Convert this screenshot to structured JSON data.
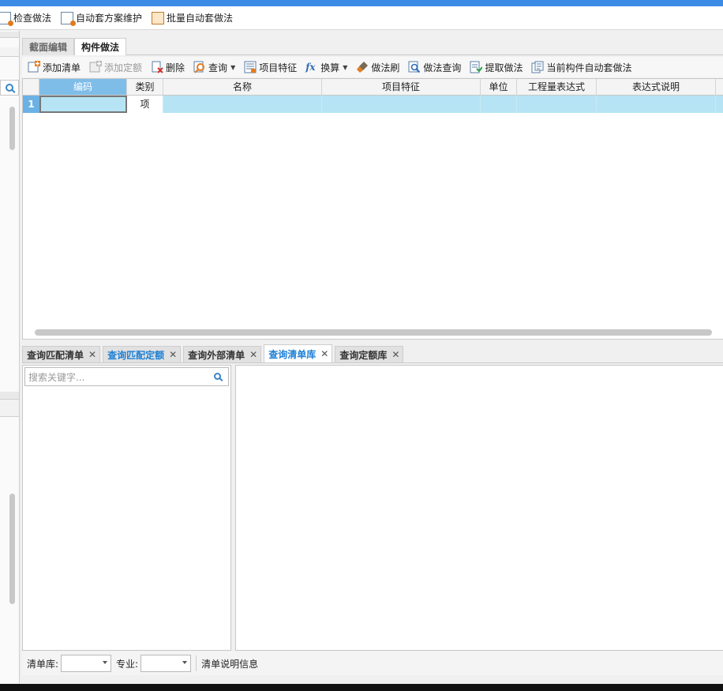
{
  "top_toolbar": {
    "items": [
      {
        "label": "检查做法",
        "icon": "check-method-icon"
      },
      {
        "label": "自动套方案维护",
        "icon": "auto-scheme-icon"
      },
      {
        "label": "批量自动套做法",
        "icon": "batch-apply-icon"
      }
    ]
  },
  "main_tabs": [
    {
      "label": "截面编辑",
      "active": false
    },
    {
      "label": "构件做法",
      "active": true
    }
  ],
  "method_toolbar": {
    "add_list": "添加清单",
    "add_quota": "添加定额",
    "delete": "删除",
    "query": "查询",
    "item_features": "项目特征",
    "convert": "换算",
    "method_brush": "做法刷",
    "method_query": "做法查询",
    "extract_method": "提取做法",
    "current_auto": "当前构件自动套做法"
  },
  "grid": {
    "columns": [
      "编码",
      "类别",
      "名称",
      "项目特征",
      "单位",
      "工程量表达式",
      "表达式说明"
    ],
    "rows": [
      {
        "num": "1",
        "code": "",
        "type": "项",
        "name": "",
        "features": "",
        "unit": "",
        "expr": "",
        "expr_desc": ""
      }
    ]
  },
  "query_tabs": [
    {
      "label": "查询匹配清单",
      "active": false,
      "blue": false
    },
    {
      "label": "查询匹配定额",
      "active": false,
      "blue": true
    },
    {
      "label": "查询外部清单",
      "active": false,
      "blue": false
    },
    {
      "label": "查询清单库",
      "active": true,
      "blue": true
    },
    {
      "label": "查询定额库",
      "active": false,
      "blue": false
    }
  ],
  "search": {
    "placeholder": "搜索关键字..."
  },
  "bottom_bar": {
    "list_lib_label": "清单库:",
    "specialty_label": "专业:",
    "info_label": "清单说明信息"
  },
  "colors": {
    "accent": "#3c8ce6",
    "header_selected": "#7fbde9",
    "row_selected": "#b6e4f5"
  }
}
